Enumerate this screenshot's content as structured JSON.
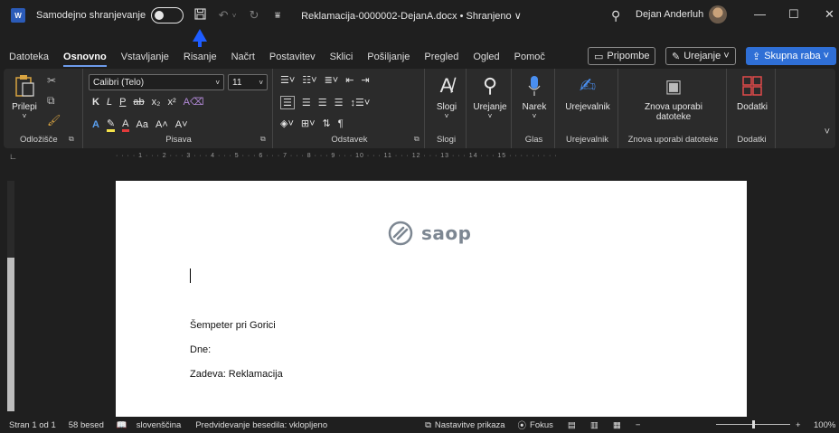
{
  "titlebar": {
    "app_badge": "W",
    "autosave_label": "Samodejno shranjevanje",
    "document_title": "Reklamacija-0000002-DejanA.docx • Shranjeno ∨",
    "username": "Dejan Anderluh"
  },
  "tabs": [
    {
      "label": "Datoteka"
    },
    {
      "label": "Osnovno"
    },
    {
      "label": "Vstavljanje"
    },
    {
      "label": "Risanje"
    },
    {
      "label": "Načrt"
    },
    {
      "label": "Postavitev"
    },
    {
      "label": "Sklici"
    },
    {
      "label": "Pošiljanje"
    },
    {
      "label": "Pregled"
    },
    {
      "label": "Ogled"
    },
    {
      "label": "Pomoč"
    }
  ],
  "tab_buttons": {
    "comments": "Pripombe",
    "editing": "Urejanje ˅",
    "share": "Skupna raba ˅"
  },
  "ribbon": {
    "clipboard": {
      "paste": "Prilepi",
      "label": "Odložišče"
    },
    "font": {
      "name": "Calibri (Telo)",
      "size": "11",
      "label": "Pisava",
      "case": "Aa"
    },
    "paragraph": {
      "label": "Odstavek"
    },
    "styles": {
      "button": "Slogi",
      "label": "Slogi"
    },
    "editing": {
      "button": "Urejanje"
    },
    "voice": {
      "button": "Narek",
      "label": "Glas"
    },
    "editor": {
      "button": "Urejevalnik",
      "label": "Urejevalnik"
    },
    "reuse": {
      "button": "Znova uporabi datoteke",
      "label": "Znova uporabi datoteke"
    },
    "addins": {
      "button": "Dodatki",
      "label": "Dodatki"
    }
  },
  "document": {
    "logo_text": "saop",
    "lines": [
      "Šempeter pri Gorici",
      "Dne:",
      "Zadeva: Reklamacija"
    ]
  },
  "statusbar": {
    "page": "Stran 1 od 1",
    "words": "58 besed",
    "language": "slovenščina",
    "prediction": "Predvidevanje besedila: vklopljeno",
    "accessibility": "Nastavitve prikaza",
    "focus": "Fokus",
    "zoom": "100%"
  },
  "colors": {
    "accent": "#2f6fd6",
    "annotation_arrow": "#1e5cff",
    "word_blue": "#2b5bb8"
  }
}
